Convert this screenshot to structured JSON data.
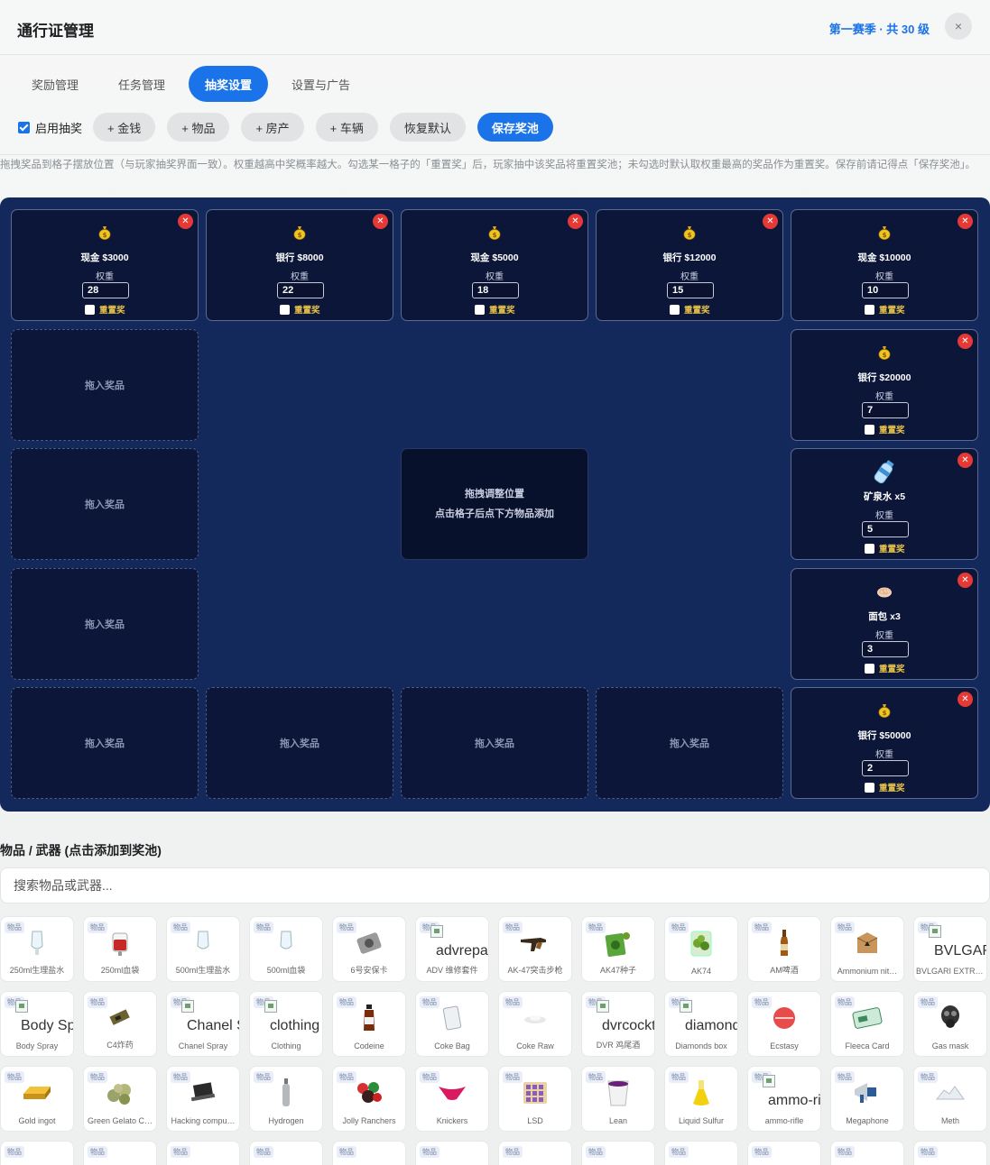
{
  "header": {
    "title": "通行证管理",
    "season": "第一赛季 · 共 30 级",
    "close": "×"
  },
  "tabs": [
    "奖励管理",
    "任务管理",
    "抽奖设置",
    "设置与广告"
  ],
  "active_tab": 2,
  "toolbar": {
    "enable_label": "启用抽奖",
    "buttons": [
      "+ 金钱",
      "+ 物品",
      "+ 房产",
      "+ 车辆",
      "恢复默认",
      "保存奖池"
    ]
  },
  "hint": "拖拽奖品到格子摆放位置（与玩家抽奖界面一致）。权重越高中奖概率越大。勾选某一格子的「重置奖」后，玩家抽中该奖品将重置奖池；未勾选时默认取权重最高的奖品作为重置奖。保存前请记得点「保存奖池」。",
  "board": {
    "weight_label": "权重",
    "reset_label": "重置奖",
    "empty_label": "拖入奖品",
    "center_line1": "拖拽调整位置",
    "center_line2": "点击格子后点下方物品添加",
    "filled": [
      {
        "name": "现金 $3000",
        "weight": "28",
        "icon": "money-bag-icon"
      },
      {
        "name": "银行 $8000",
        "weight": "22",
        "icon": "money-bag-icon"
      },
      {
        "name": "现金 $5000",
        "weight": "18",
        "icon": "money-bag-icon"
      },
      {
        "name": "银行 $12000",
        "weight": "15",
        "icon": "money-bag-icon"
      },
      {
        "name": "现金 $10000",
        "weight": "10",
        "icon": "money-bag-icon"
      },
      {
        "name": "银行 $20000",
        "weight": "7",
        "icon": "money-bag-icon"
      },
      {
        "name": "矿泉水 x5",
        "weight": "5",
        "icon": "water-bottle-icon"
      },
      {
        "name": "面包 x3",
        "weight": "3",
        "icon": "bread-icon"
      },
      {
        "name": "银行 $50000",
        "weight": "2",
        "icon": "money-bag-icon"
      }
    ]
  },
  "items_section": {
    "title": "物品 / 武器 (点击添加到奖池)",
    "search_placeholder": "搜索物品或武器...",
    "tag": "物品",
    "rows": [
      [
        "250ml生理盐水",
        "250ml血袋",
        "500ml生理盐水",
        "500ml血袋",
        "6号安保卡",
        "ADV 维修套件",
        "AK-47突击步枪",
        "AK47种子",
        "AK74",
        "AM啤酒",
        "Ammonium nit…",
        "BVLGARI EXTREME"
      ],
      [
        "Body Spray",
        "C4炸药",
        "Chanel Spray",
        "Clothing",
        "Codeine",
        "Coke Bag",
        "Coke Raw",
        "DVR 鸡尾酒",
        "Diamonds box",
        "Ecstasy",
        "Fleeca Card",
        "Gas mask"
      ],
      [
        "Gold ingot",
        "Green Gelato C…",
        "Hacking compu…",
        "Hydrogen",
        "Jolly Ranchers",
        "Knickers",
        "LSD",
        "Lean",
        "Liquid Sulfur",
        "ammo-rifle",
        "Megaphone",
        "Meth"
      ]
    ],
    "alt_texts": {
      "advrepairkit": "advrepairkit",
      "bvlgari": "BVLGARI EXTREME",
      "body_spray": "Body Spray",
      "chanel": "Chanel Spray",
      "clothing": "clothing",
      "dvrcocktail": "dvrcocktail",
      "diamonds": "diamonds_box",
      "ammo": "ammo-rifle"
    }
  }
}
